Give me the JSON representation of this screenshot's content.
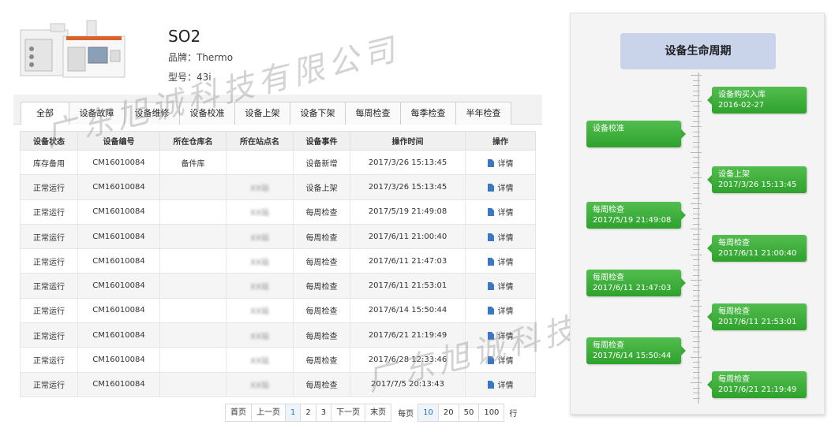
{
  "device": {
    "name": "SO2",
    "brand": "品牌：Thermo",
    "model": "型号：43i"
  },
  "tabs": [
    "全部",
    "设备故障",
    "设备维修",
    "设备校准",
    "设备上架",
    "设备下架",
    "每周检查",
    "每季检查",
    "半年检查"
  ],
  "table": {
    "headers": [
      "设备状态",
      "设备编号",
      "所在仓库名",
      "所在站点名",
      "设备事件",
      "操作时间",
      "操作"
    ],
    "rows": [
      {
        "status": "库存备用",
        "id": "CM16010084",
        "warehouse": "备件库",
        "site": "",
        "event": "设备新增",
        "time": "2017/3/26 15:13:45",
        "action": "详情"
      },
      {
        "status": "正常运行",
        "id": "CM16010084",
        "warehouse": "",
        "site": "XX站",
        "event": "设备上架",
        "time": "2017/3/26 15:13:45",
        "action": "详情"
      },
      {
        "status": "正常运行",
        "id": "CM16010084",
        "warehouse": "",
        "site": "XX站",
        "event": "每周检查",
        "time": "2017/5/19 21:49:08",
        "action": "详情"
      },
      {
        "status": "正常运行",
        "id": "CM16010084",
        "warehouse": "",
        "site": "XX站",
        "event": "每周检查",
        "time": "2017/6/11 21:00:40",
        "action": "详情"
      },
      {
        "status": "正常运行",
        "id": "CM16010084",
        "warehouse": "",
        "site": "XX站",
        "event": "每周检查",
        "time": "2017/6/11 21:47:03",
        "action": "详情"
      },
      {
        "status": "正常运行",
        "id": "CM16010084",
        "warehouse": "",
        "site": "XX站",
        "event": "每周检查",
        "time": "2017/6/11 21:53:01",
        "action": "详情"
      },
      {
        "status": "正常运行",
        "id": "CM16010084",
        "warehouse": "",
        "site": "XX站",
        "event": "每周检查",
        "time": "2017/6/14 15:50:44",
        "action": "详情"
      },
      {
        "status": "正常运行",
        "id": "CM16010084",
        "warehouse": "",
        "site": "XX站",
        "event": "每周检查",
        "time": "2017/6/21 21:19:49",
        "action": "详情"
      },
      {
        "status": "正常运行",
        "id": "CM16010084",
        "warehouse": "",
        "site": "XX站",
        "event": "每周检查",
        "time": "2017/6/28 12:33:46",
        "action": "详情"
      },
      {
        "status": "正常运行",
        "id": "CM16010084",
        "warehouse": "",
        "site": "XX站",
        "event": "每周检查",
        "time": "2017/7/5 20:13:43",
        "action": "详情"
      }
    ]
  },
  "pagination": {
    "first": "首页",
    "prev": "上一页",
    "pages": [
      "1",
      "2",
      "3"
    ],
    "current_page": "1",
    "next": "下一页",
    "last": "末页",
    "per_page_label": "每页",
    "per_page_options": [
      "10",
      "20",
      "50",
      "100"
    ],
    "per_page_selected": "10",
    "unit": "行"
  },
  "watermark": "广东旭诚科技有限公司",
  "lifecycle": {
    "title": "设备生命周期",
    "events": [
      {
        "side": "right",
        "label": "设备购买入库",
        "date": "2016-02-27"
      },
      {
        "side": "left",
        "label": "设备校准",
        "date": ""
      },
      {
        "side": "right",
        "label": "设备上架",
        "date": "2017/3/26 15:13:45"
      },
      {
        "side": "left",
        "label": "每周检查",
        "date": "2017/5/19 21:49:08"
      },
      {
        "side": "right",
        "label": "每周检查",
        "date": "2017/6/11 21:00:40"
      },
      {
        "side": "left",
        "label": "每周检查",
        "date": "2017/6/11 21:47:03"
      },
      {
        "side": "right",
        "label": "每周检查",
        "date": "2017/6/11 21:53:01"
      },
      {
        "side": "left",
        "label": "每周检查",
        "date": "2017/6/14 15:50:44"
      },
      {
        "side": "right",
        "label": "每周检查",
        "date": "2017/6/21 21:19:49"
      }
    ]
  },
  "colors": {
    "event_green": "#3eac3e",
    "title_box": "#c9d4ea",
    "link_blue": "#2a6fb8"
  }
}
